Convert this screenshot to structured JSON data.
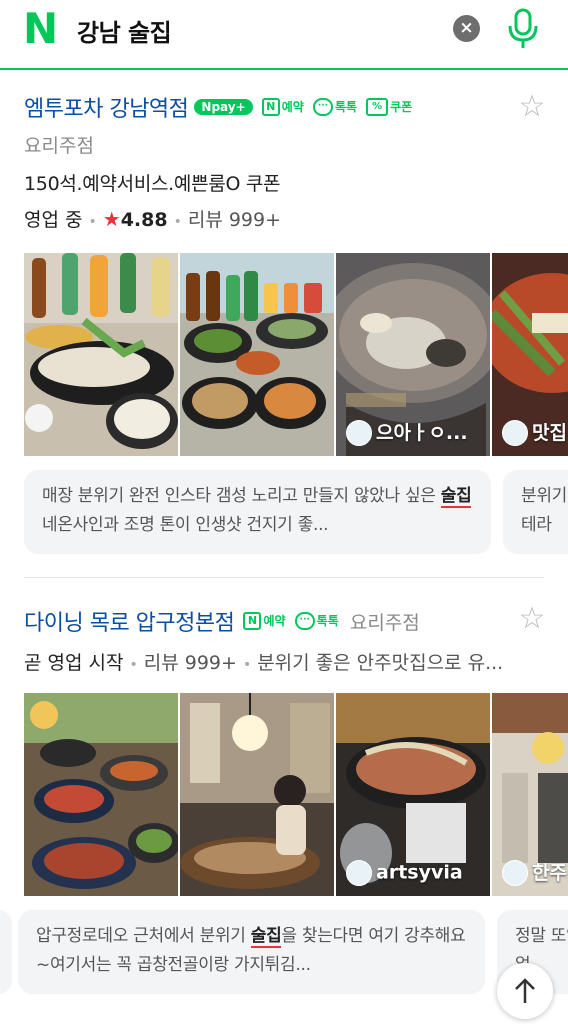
{
  "search": {
    "logo": "N",
    "query": "강남 술집",
    "clear_icon": "×"
  },
  "results": [
    {
      "name": "엠투포차 강남역점",
      "badges": {
        "npay": "pay",
        "reserve": "예약",
        "talk": "톡톡",
        "coupon": "쿠폰"
      },
      "category": "요리주점",
      "description": "150석.예약서비스.예쁜룸O 쿠폰",
      "status": "영업 중",
      "rating": "4.88",
      "reviews": "리뷰 999+",
      "photo_captions": [
        "으아ㅏㅇ...",
        "맛집"
      ],
      "snippets": [
        {
          "pre": "매장 분위기 완전 인스타 갬성 노리고 만들지 않았나 싶은 ",
          "hl": "술집",
          "post": "네온사인과 조명 톤이 인생샷 건지기 좋..."
        },
        {
          "pre": "분위기 ",
          "hl": "",
          "post": "고 테라"
        }
      ]
    },
    {
      "name": "다이닝 목로 압구정본점",
      "badges": {
        "reserve": "예약",
        "talk": "톡톡"
      },
      "category": "요리주점",
      "status": "곧 영업 시작",
      "reviews": "리뷰 999+",
      "extra": "분위기 좋은 안주맛집으로 유...",
      "photo_captions": [
        "artsyvia",
        "한주"
      ],
      "snippets": [
        {
          "pre": "압구정로데오 근처에서 분위기 ",
          "hl": "술집",
          "post": "을 찾는다면 여기 강추해요~여기서는 꼭 곱창전골이랑 가지튀김..."
        },
        {
          "pre": "정말 또",
          "hl": "",
          "post": "있고 얼"
        }
      ]
    }
  ]
}
